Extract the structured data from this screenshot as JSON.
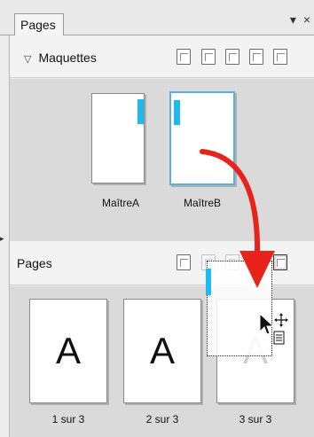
{
  "panel": {
    "tab_label": "Pages",
    "tab_menu_glyph": "▾",
    "tab_close_glyph": "×"
  },
  "masters_section": {
    "caret_glyph": "▽",
    "title": "Maquettes",
    "masters": [
      {
        "label": "MaîtreA",
        "selected": false
      },
      {
        "label": "MaîtreB",
        "selected": true
      }
    ],
    "toolbar_icons": [
      "master-settings-icon",
      "new-master-icon",
      "duplicate-master-icon",
      "delete-master-icon",
      "master-properties-icon"
    ]
  },
  "pages_section": {
    "title": "Pages",
    "toolbar_icons": [
      "page-settings-icon",
      "insert-page-icon",
      "duplicate-page-icon",
      "delete-page-icon",
      "page-properties-icon"
    ],
    "pages": [
      {
        "letter": "A",
        "label": "1 sur 3"
      },
      {
        "letter": "A",
        "label": "2 sur 3"
      },
      {
        "letter": "A",
        "label": "3 sur 3"
      }
    ]
  },
  "colors": {
    "accent_blue": "#1fb9f0",
    "selection_border": "#5aaee0",
    "arrow_red": "#e8231b"
  }
}
